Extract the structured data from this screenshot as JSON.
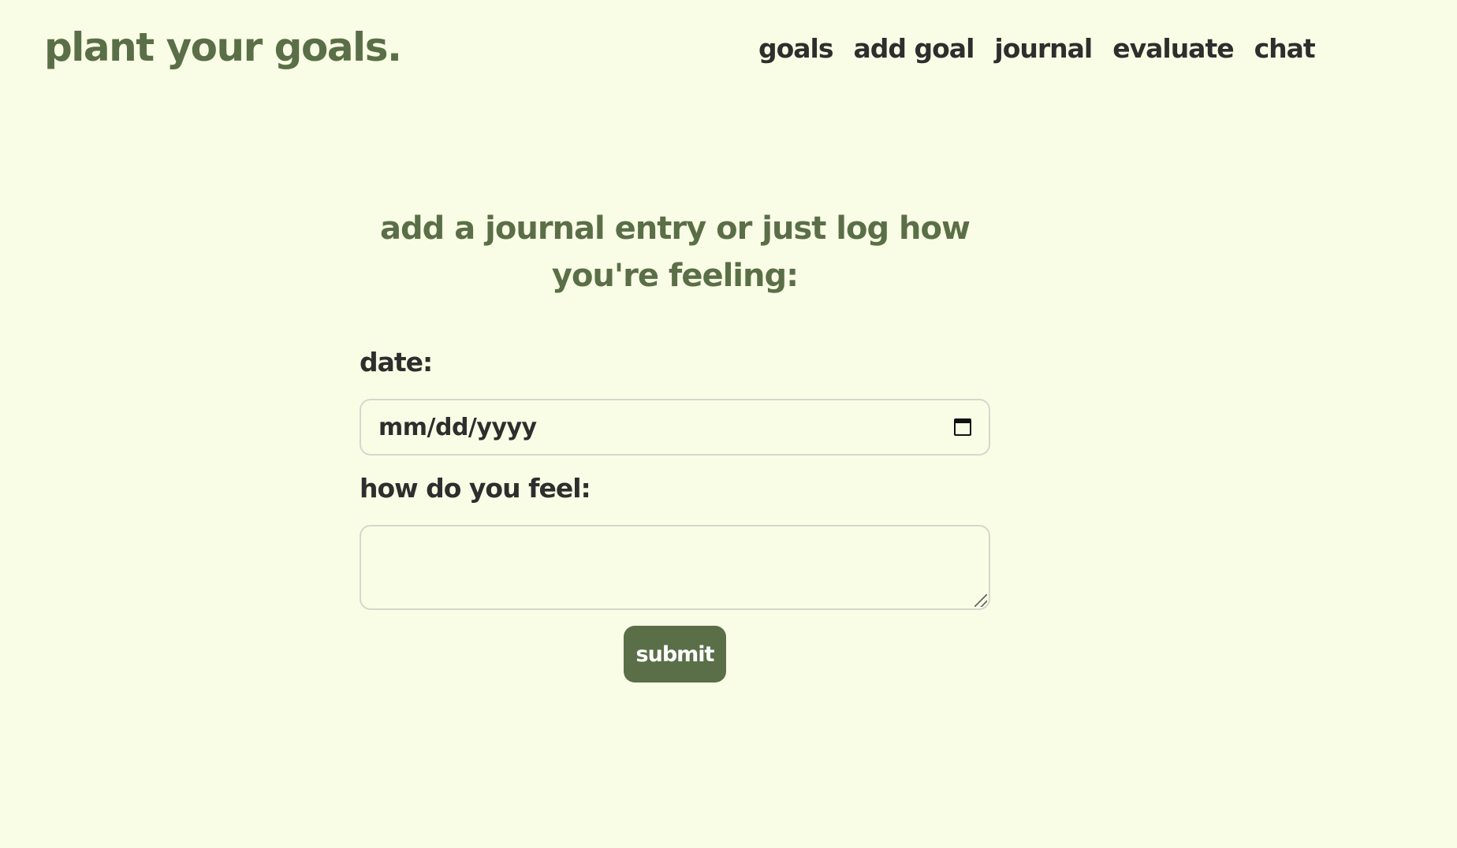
{
  "header": {
    "brand": "plant your goals.",
    "nav": [
      {
        "label": "goals"
      },
      {
        "label": "add goal"
      },
      {
        "label": "journal"
      },
      {
        "label": "evaluate"
      },
      {
        "label": "chat"
      }
    ]
  },
  "form": {
    "heading_line1": "add a journal entry or just log how",
    "heading_line2": "you're feeling:",
    "date_label": "date:",
    "date_placeholder": "mm/dd/yyyy",
    "feel_label": "how do you feel:",
    "feel_value": "",
    "submit_label": "submit"
  },
  "colors": {
    "background": "#fafde5",
    "accent": "#5a6f47",
    "text": "#2e2e2e"
  }
}
